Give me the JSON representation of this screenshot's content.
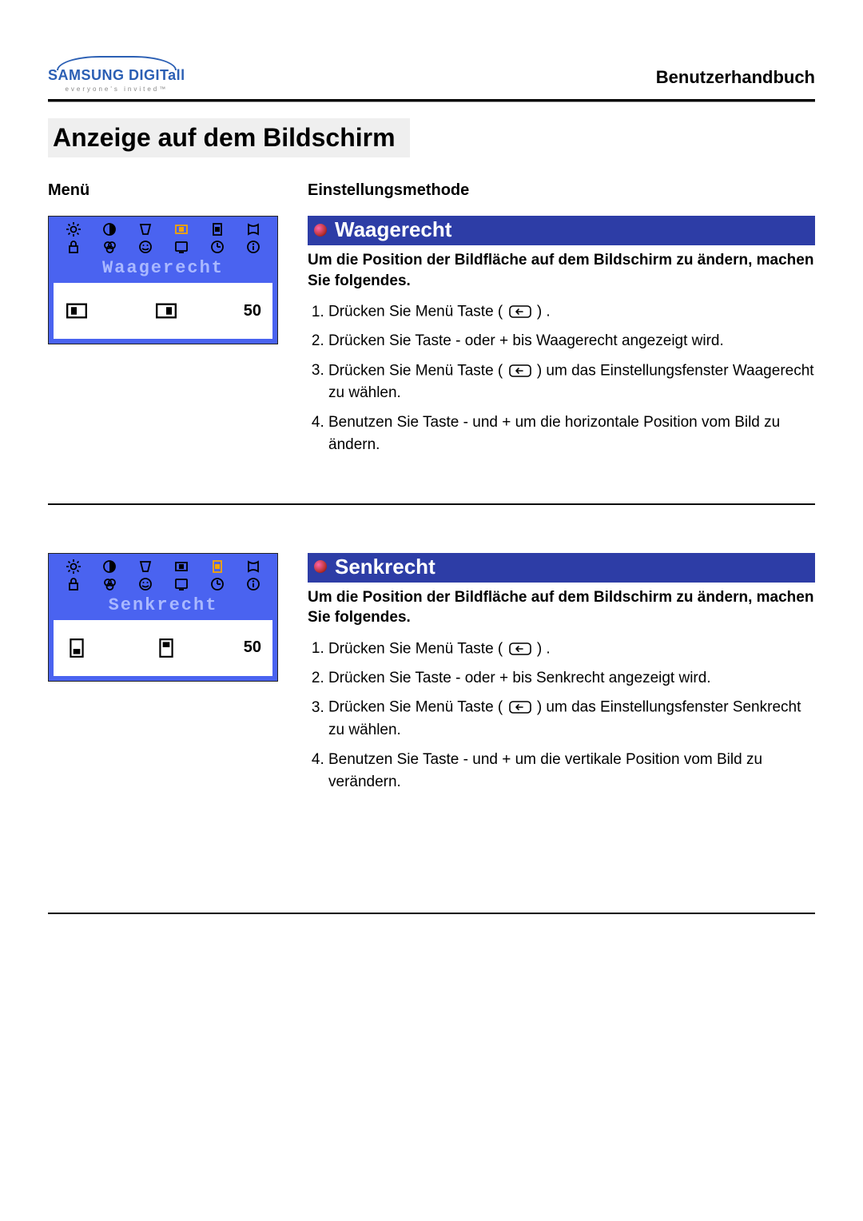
{
  "brand": {
    "name": "SAMSUNG DIGITall",
    "tagline": "everyone's invited™"
  },
  "doc_title": "Benutzerhandbuch",
  "page_title": "Anzeige auf dem Bildschirm",
  "columns": {
    "menu": "Menü",
    "method": "Einstellungsmethode"
  },
  "sections": [
    {
      "osd_label": "Waagerecht",
      "osd_value": "50",
      "highlight_index": 3,
      "title": "Waagerecht",
      "intro": "Um die Position der Bildfläche auf dem Bildschirm zu ändern, machen Sie folgendes.",
      "steps": {
        "s1a": "Drücken Sie Menü Taste (",
        "s1b": ") .",
        "s2": "Drücken Sie Taste - oder + bis Waagerecht angezeigt wird.",
        "s3a": "Drücken Sie Menü Taste (",
        "s3b": ") um das Einstellungsfenster Waagerecht zu wählen.",
        "s4": "Benutzen Sie Taste - und + um die horizontale Position vom Bild zu ändern."
      }
    },
    {
      "osd_label": "Senkrecht",
      "osd_value": "50",
      "highlight_index": 4,
      "title": "Senkrecht",
      "intro": "Um die Position der Bildfläche auf dem Bildschirm zu ändern, machen Sie folgendes.",
      "steps": {
        "s1a": "Drücken Sie Menü Taste (",
        "s1b": ") .",
        "s2": "Drücken Sie Taste - oder + bis Senkrecht angezeigt wird.",
        "s3a": "Drücken Sie Menü Taste (",
        "s3b": ") um das Einstellungsfenster Senkrecht zu wählen.",
        "s4": "Benutzen Sie Taste - und + um die vertikale Position vom Bild zu verändern."
      }
    }
  ]
}
